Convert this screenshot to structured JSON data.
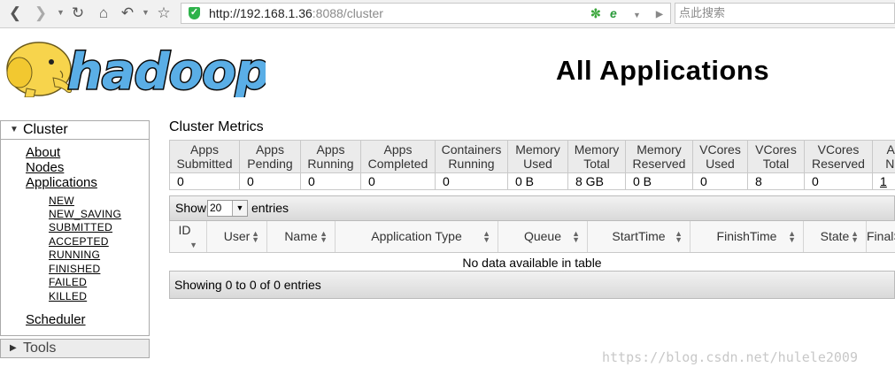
{
  "browser": {
    "url_host": "http://192.168.1.36",
    "url_path": ":8088/cluster",
    "search_placeholder": "点此搜索",
    "ie_mode_label": "e"
  },
  "header": {
    "logo_text": "hadoop",
    "title": "All Applications"
  },
  "nav": {
    "cluster": {
      "label": "Cluster",
      "links": [
        "About",
        "Nodes",
        "Applications"
      ],
      "app_states": [
        "NEW",
        "NEW_SAVING",
        "SUBMITTED",
        "ACCEPTED",
        "RUNNING",
        "FINISHED",
        "FAILED",
        "KILLED"
      ],
      "scheduler": "Scheduler"
    },
    "tools": {
      "label": "Tools"
    }
  },
  "metrics": {
    "title": "Cluster Metrics",
    "headers": [
      [
        "Apps",
        "Submitted"
      ],
      [
        "Apps",
        "Pending"
      ],
      [
        "Apps",
        "Running"
      ],
      [
        "Apps",
        "Completed"
      ],
      [
        "Containers",
        "Running"
      ],
      [
        "Memory",
        "Used"
      ],
      [
        "Memory",
        "Total"
      ],
      [
        "Memory",
        "Reserved"
      ],
      [
        "VCores",
        "Used"
      ],
      [
        "VCores",
        "Total"
      ],
      [
        "VCores",
        "Reserved"
      ],
      [
        "Active",
        "Nodes"
      ]
    ],
    "values": [
      "0",
      "0",
      "0",
      "0",
      "0",
      "0 B",
      "8 GB",
      "0 B",
      "0",
      "8",
      "0",
      "1"
    ]
  },
  "apps_table": {
    "show_label": "Show",
    "page_size": "20",
    "entries_label": "entries",
    "columns": [
      "ID",
      "User",
      "Name",
      "Application Type",
      "Queue",
      "StartTime",
      "FinishTime",
      "State",
      "FinalStatus"
    ],
    "empty_text": "No data available in table",
    "info_text": "Showing 0 to 0 of 0 entries"
  },
  "watermark": "https://blog.csdn.net/hulele2009",
  "colors": {
    "hadoop_blue": "#5aaee6",
    "hadoop_yellow": "#f7d44c",
    "secure_green": "#2db24a"
  }
}
